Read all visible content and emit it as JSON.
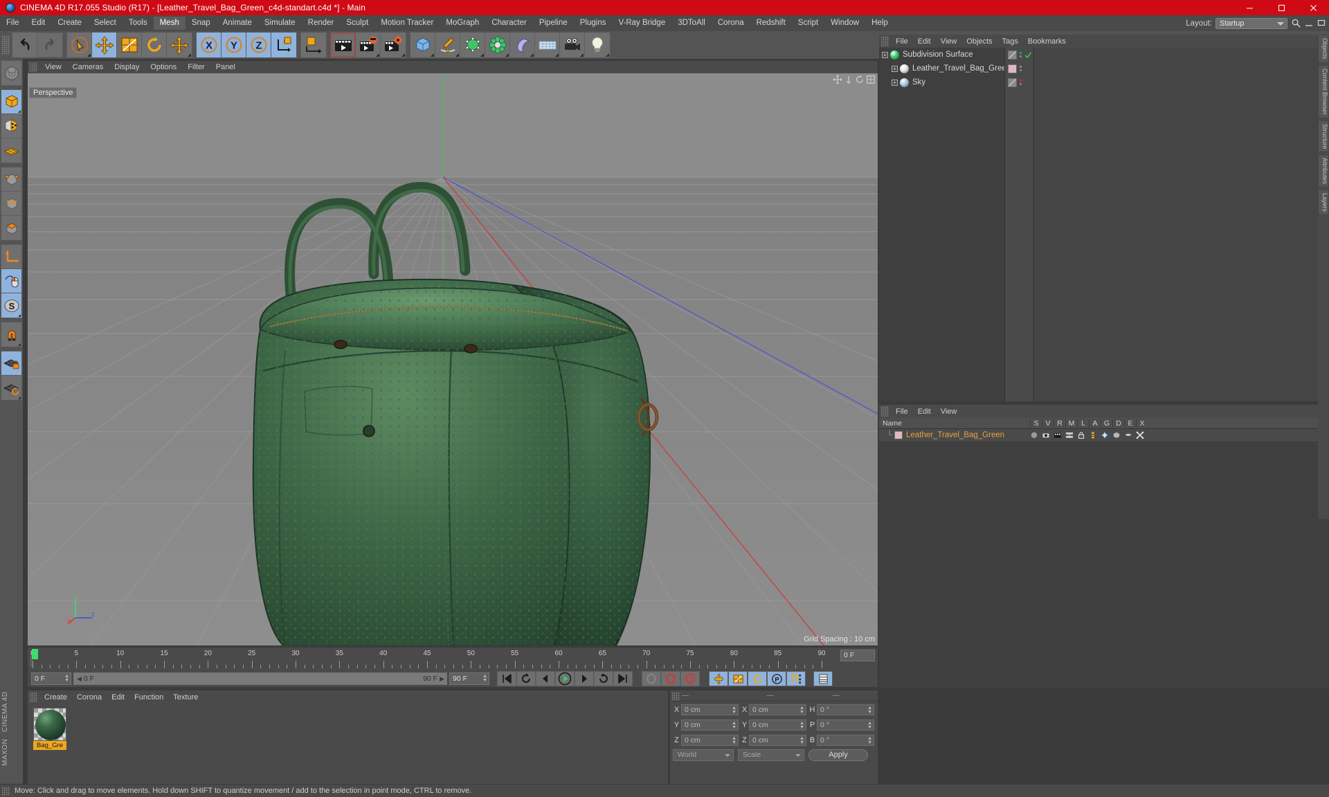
{
  "titlebar": {
    "title": "CINEMA 4D R17.055 Studio (R17) - [Leather_Travel_Bag_Green_c4d-standart.c4d *] - Main",
    "minimize": "—",
    "maximize": "□",
    "close": "✕"
  },
  "menubar": {
    "items": [
      {
        "label": "File",
        "active": false
      },
      {
        "label": "Edit",
        "active": false
      },
      {
        "label": "Create",
        "active": false
      },
      {
        "label": "Select",
        "active": false
      },
      {
        "label": "Tools",
        "active": false
      },
      {
        "label": "Mesh",
        "active": true
      },
      {
        "label": "Snap",
        "active": false
      },
      {
        "label": "Animate",
        "active": false
      },
      {
        "label": "Simulate",
        "active": false
      },
      {
        "label": "Render",
        "active": false
      },
      {
        "label": "Sculpt",
        "active": false
      },
      {
        "label": "Motion Tracker",
        "active": false
      },
      {
        "label": "MoGraph",
        "active": false
      },
      {
        "label": "Character",
        "active": false
      },
      {
        "label": "Pipeline",
        "active": false
      },
      {
        "label": "Plugins",
        "active": false
      },
      {
        "label": "V-Ray Bridge",
        "active": false
      },
      {
        "label": "3DToAll",
        "active": false
      },
      {
        "label": "Corona",
        "active": false
      },
      {
        "label": "Redshift",
        "active": false
      },
      {
        "label": "Script",
        "active": false
      },
      {
        "label": "Window",
        "active": false
      },
      {
        "label": "Help",
        "active": false
      }
    ],
    "layout_label": "Layout:",
    "layout_value": "Startup"
  },
  "viewport": {
    "menu": [
      "View",
      "Cameras",
      "Display",
      "Options",
      "Filter",
      "Panel"
    ],
    "view_name": "Perspective",
    "grid_spacing": "Grid Spacing : 10 cm",
    "bg_color": "#888888",
    "model_color": "#3c6b49"
  },
  "object_manager": {
    "menu": [
      "File",
      "Edit",
      "View",
      "Objects",
      "Tags",
      "Bookmarks"
    ],
    "rows": [
      {
        "label": "Subdivision Surface",
        "indent": 0,
        "icon": "subdivision-surface-icon",
        "icon_color": "#35d06a",
        "tag_color": "#7d7d7d",
        "check": true,
        "dot_color": "#00c853"
      },
      {
        "label": "Leather_Travel_Bag_Green",
        "indent": 1,
        "icon": "object-icon",
        "icon_color": "#e6e6e6",
        "tag_color": "#e0b8c4",
        "check": false,
        "dot_color": "#9a9a9a"
      },
      {
        "label": "Sky",
        "indent": 1,
        "icon": "sky-icon",
        "icon_color": "#a8c8e8",
        "tag_color": "#7d7d7d",
        "check": false,
        "dot_color": "#d03030"
      }
    ]
  },
  "material_manager": {
    "menu": [
      "File",
      "Edit",
      "View"
    ],
    "columns": [
      "Name",
      "S",
      "V",
      "R",
      "M",
      "L",
      "A",
      "G",
      "D",
      "E",
      "X"
    ],
    "rows": [
      {
        "name": "Leather_Travel_Bag_Green",
        "swatch": "#e0b8c4"
      }
    ]
  },
  "timeline": {
    "labels": [
      "0",
      "5",
      "10",
      "15",
      "20",
      "25",
      "30",
      "35",
      "40",
      "45",
      "50",
      "55",
      "60",
      "65",
      "70",
      "75",
      "80",
      "85",
      "90"
    ],
    "min": 0,
    "max": 90,
    "current_frame": "0 F",
    "frame_field_right": "0 F",
    "range_start": "0 F",
    "range_end": "90 F",
    "preview_end": "90 F",
    "transport": [
      "go-to-start-icon",
      "play-backwards-loop-icon",
      "step-back-icon",
      "play-icon",
      "step-forward-icon",
      "loop-icon",
      "go-to-end-icon"
    ],
    "record_buttons": [
      "autokey-icon",
      "record-active-objects-icon",
      "record-parameters-icon"
    ],
    "key_toggles": [
      "position-key-icon",
      "scale-key-icon",
      "rotation-key-icon",
      "param-key-icon",
      "pla-key-icon",
      "keyframe-selection-icon"
    ]
  },
  "material_panel": {
    "menu": [
      "Create",
      "Corona",
      "Edit",
      "Function",
      "Texture"
    ],
    "material_label": "Bag_Gre",
    "material_label_full": "Bag_Green"
  },
  "coordinates": {
    "headers": [
      "—",
      "—",
      "—"
    ],
    "rows": [
      {
        "l1": "X",
        "v1": "0 cm",
        "l2": "X",
        "v2": "0 cm",
        "l3": "H",
        "v3": "0 °"
      },
      {
        "l1": "Y",
        "v1": "0 cm",
        "l2": "Y",
        "v2": "0 cm",
        "l3": "P",
        "v3": "0 °"
      },
      {
        "l1": "Z",
        "v1": "0 cm",
        "l2": "Z",
        "v2": "0 cm",
        "l3": "B",
        "v3": "0 °"
      }
    ],
    "space_value": "World",
    "mode_value": "Scale",
    "apply_label": "Apply"
  },
  "edge_tabs": [
    {
      "label": "Objects"
    },
    {
      "label": "Content Browser"
    },
    {
      "label": "Structure"
    },
    {
      "label": "Attributes"
    },
    {
      "label": "Layers"
    }
  ],
  "statusbar": {
    "message": "Move: Click and drag to move elements. Hold down SHIFT to quantize movement / add to the selection in point mode, CTRL to remove."
  },
  "brand": {
    "logo_top": "MAXON",
    "logo_bottom": "CINEMA 4D"
  },
  "toolbar": {
    "groups": [
      {
        "name": "history",
        "buttons": [
          {
            "name": "undo-icon",
            "selected": false,
            "disabled": false,
            "corner": false
          },
          {
            "name": "redo-icon",
            "selected": false,
            "disabled": true,
            "corner": false
          }
        ]
      },
      {
        "name": "transform",
        "buttons": [
          {
            "name": "live-selection-icon",
            "selected": false,
            "disabled": false,
            "corner": true
          },
          {
            "name": "move-tool-icon",
            "selected": true,
            "disabled": false,
            "corner": false
          },
          {
            "name": "scale-tool-icon",
            "selected": false,
            "disabled": false,
            "corner": false
          },
          {
            "name": "rotate-tool-icon",
            "selected": false,
            "disabled": false,
            "corner": false
          },
          {
            "name": "move-dup-icon",
            "selected": false,
            "disabled": false,
            "corner": true
          }
        ]
      },
      {
        "name": "axis-lock",
        "buttons": [
          {
            "name": "lock-x-axis-icon",
            "selected": true,
            "disabled": false,
            "corner": false
          },
          {
            "name": "lock-y-axis-icon",
            "selected": true,
            "disabled": false,
            "corner": false
          },
          {
            "name": "lock-z-axis-icon",
            "selected": true,
            "disabled": false,
            "corner": false
          },
          {
            "name": "world-coordinate-icon",
            "selected": false,
            "disabled": false,
            "corner": false
          }
        ]
      },
      {
        "name": "render-extra",
        "buttons": [
          {
            "name": "object-axis-icon",
            "selected": false,
            "disabled": false,
            "corner": false
          }
        ]
      },
      {
        "name": "render",
        "buttons": [
          {
            "name": "render-view-icon",
            "selected": false,
            "disabled": false,
            "corner": false,
            "outline": true
          },
          {
            "name": "render-to-picture-viewer-icon",
            "selected": false,
            "disabled": false,
            "corner": true
          },
          {
            "name": "render-settings-icon",
            "selected": false,
            "disabled": false,
            "corner": true
          }
        ]
      },
      {
        "name": "create",
        "buttons": [
          {
            "name": "add-cube-icon",
            "selected": false,
            "disabled": false,
            "corner": true
          },
          {
            "name": "add-spline-icon",
            "selected": false,
            "disabled": false,
            "corner": true
          },
          {
            "name": "add-generator-icon",
            "selected": false,
            "disabled": false,
            "corner": true
          },
          {
            "name": "add-array-icon",
            "selected": false,
            "disabled": false,
            "corner": true
          },
          {
            "name": "add-bend-deformer-icon",
            "selected": false,
            "disabled": false,
            "corner": true
          },
          {
            "name": "add-floor-icon",
            "selected": false,
            "disabled": false,
            "corner": true
          },
          {
            "name": "add-camera-icon",
            "selected": false,
            "disabled": false,
            "corner": true
          },
          {
            "name": "add-light-icon",
            "selected": false,
            "disabled": false,
            "corner": true
          }
        ]
      }
    ]
  },
  "left_toolbar": {
    "groups": [
      {
        "name": "g0",
        "buttons": [
          {
            "name": "make-editable-icon",
            "selected": false
          }
        ]
      },
      {
        "name": "g1",
        "buttons": [
          {
            "name": "model-mode-icon",
            "selected": true
          },
          {
            "name": "texture-mode-icon",
            "selected": false
          },
          {
            "name": "workplane-mode-icon",
            "selected": false
          }
        ]
      },
      {
        "name": "g2",
        "buttons": [
          {
            "name": "points-mode-icon",
            "selected": false
          },
          {
            "name": "edges-mode-icon",
            "selected": false
          },
          {
            "name": "polygons-mode-icon",
            "selected": false
          }
        ]
      },
      {
        "name": "g3",
        "buttons": [
          {
            "name": "object-axis-mode-icon",
            "selected": false
          },
          {
            "name": "enable-axis-modification-icon",
            "selected": true
          },
          {
            "name": "soft-selection-icon",
            "selected": true
          }
        ]
      },
      {
        "name": "g4",
        "buttons": [
          {
            "name": "magnet-tool-icon",
            "selected": false
          }
        ]
      },
      {
        "name": "g5",
        "buttons": [
          {
            "name": "workplane-lock-icon",
            "selected": true
          },
          {
            "name": "workplane-rotate-icon",
            "selected": false
          }
        ]
      }
    ]
  },
  "chart_data": null
}
